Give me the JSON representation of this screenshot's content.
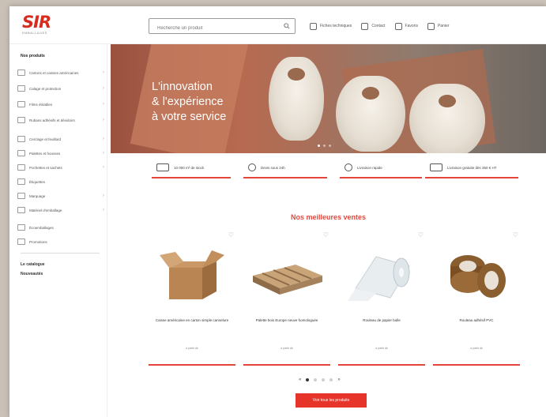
{
  "header": {
    "logo_text": "SIR",
    "logo_sub": "EMBALLAGES",
    "search_placeholder": "Recherche un produit",
    "links": [
      {
        "label": "Fiches techniques",
        "icon": "document-icon"
      },
      {
        "label": "Contact",
        "icon": "chat-icon"
      },
      {
        "label": "Favoris",
        "icon": "heart-icon"
      },
      {
        "label": "Panier",
        "icon": "cart-icon"
      }
    ]
  },
  "sidebar": {
    "title": "Nos produits",
    "items": [
      {
        "label": "Cartons et caisses américaines",
        "icon": "box-icon"
      },
      {
        "label": "Calage et protection",
        "icon": "cushion-icon"
      },
      {
        "label": "Films étirables",
        "icon": "film-icon"
      },
      {
        "label": "Rubans adhésifs et dévidoirs",
        "icon": "tape-icon"
      },
      {
        "label": "Cerclage et feuillard",
        "icon": "strap-icon"
      },
      {
        "label": "Palettes et housses",
        "icon": "pallet-icon"
      },
      {
        "label": "Pochettes et sachets",
        "icon": "bag-icon"
      },
      {
        "label": "Étiquettes",
        "icon": "label-icon"
      },
      {
        "label": "Marquage",
        "icon": "marker-icon"
      },
      {
        "label": "Matériel d'emballage",
        "icon": "tool-icon"
      },
      {
        "label": "Écoemballages",
        "icon": "leaf-icon"
      },
      {
        "label": "Promotions",
        "icon": "percent-icon"
      }
    ],
    "links": [
      "Le catalogue",
      "Nouveautés"
    ]
  },
  "hero": {
    "lines": [
      "L'innovation",
      "& l'expérience",
      "à votre service"
    ]
  },
  "features": [
    {
      "label": "10 000 m² de stock",
      "icon": "warehouse-icon"
    },
    {
      "label": "Devis sous 24h",
      "icon": "clock-icon"
    },
    {
      "label": "Livraison rapide",
      "icon": "globe-icon"
    },
    {
      "label": "Livraison gratuite dès 350 € HT",
      "icon": "truck-icon"
    }
  ],
  "products": {
    "title": "Nos meilleures ventes",
    "items": [
      {
        "name": "Caisse américaine en carton simple cannelure",
        "price": "à partir de"
      },
      {
        "name": "Palette bois Europe neuve homologuée",
        "price": "à partir de"
      },
      {
        "name": "Rouleau de papier bulle",
        "price": "à partir de"
      },
      {
        "name": "Rouleau adhésif PVC",
        "price": "à partir de"
      }
    ],
    "pager": {
      "prev": "«",
      "next": "»"
    },
    "cta": "Voir tous les produits"
  },
  "colors": {
    "accent": "#e6463a",
    "brand": "#d62d20"
  }
}
